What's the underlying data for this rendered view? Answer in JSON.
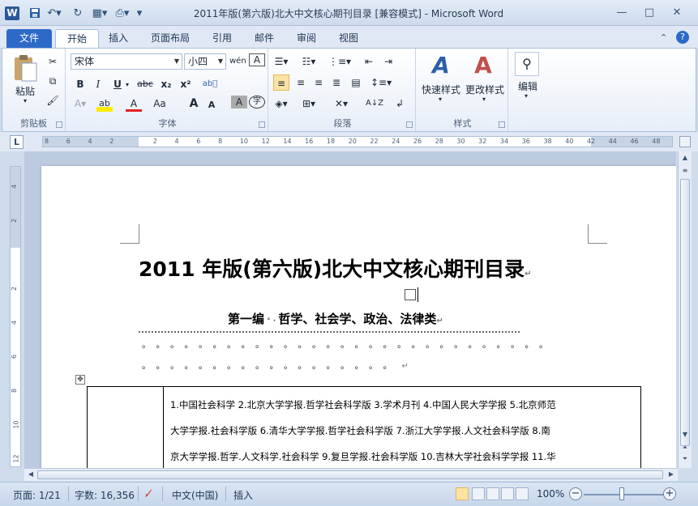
{
  "window": {
    "title": "2011年版(第六版)北大中文核心期刊目录 [兼容模式] - Microsoft Word",
    "app_icon": "W",
    "controls": {
      "minimize": "—",
      "maximize": "□",
      "close": "✕"
    }
  },
  "ribbon_tabs": [
    "文件",
    "开始",
    "插入",
    "页面布局",
    "引用",
    "邮件",
    "审阅",
    "视图"
  ],
  "ribbon": {
    "clipboard": {
      "paste_label": "粘贴",
      "group_label": "剪贴板"
    },
    "font": {
      "font_name": "宋体",
      "font_size": "小四",
      "bold": "B",
      "italic": "I",
      "underline": "U",
      "strike": "abc",
      "subscript": "x₂",
      "superscript": "x²",
      "grow": "A",
      "shrink": "A",
      "case": "Aa",
      "font_color": "A",
      "highlight": "ab",
      "char_border": "A",
      "enclose": "字",
      "phonetic": "wén",
      "group_label": "字体"
    },
    "paragraph": {
      "group_label": "段落"
    },
    "styles": {
      "quick_styles": "快速样式",
      "change_styles": "更改样式",
      "group_label": "样式"
    },
    "editing": {
      "label": "编辑"
    }
  },
  "ruler": {
    "corner": "L",
    "ticks": [
      "8",
      "6",
      "4",
      "2",
      "",
      "2",
      "4",
      "6",
      "8",
      "10",
      "12",
      "14",
      "16",
      "18",
      "20",
      "22",
      "24",
      "26",
      "28",
      "30",
      "32",
      "34",
      "36",
      "38",
      "40",
      "42",
      "44",
      "46",
      "48"
    ],
    "vticks": [
      "4",
      "2",
      "",
      "2",
      "4",
      "6",
      "8",
      "10",
      "12"
    ]
  },
  "document": {
    "title": "2011 年版(第六版)北大中文核心期刊目录",
    "subtitle": "第一编",
    "subtitle_rest": "哲学、社会学、政治、法律类",
    "para_mark": "↵",
    "dots_row1": "。。。。。。。。。。。。。。。。。。。。。。。。。。。。。",
    "dots_row2": "。。。。。。。。。。。。。。。。。。",
    "table_lines": [
      "1.中国社会科学  2.北京大学学报.哲学社会科学版  3.学术月刊  4.中国人民大学学报  5.北京师范",
      "大学学报.社会科学版  6.清华大学学报.哲学社会科学版  7.浙江大学学报.人文社会科学版  8.南",
      "京大学学报.哲学.人文科学.社会科学  9.复旦学报.社会科学版  10.吉林大学社会科学学报  11.华"
    ]
  },
  "statusbar": {
    "page": "页面: 1/21",
    "words": "字数: 16,356",
    "language": "中文(中国)",
    "mode": "插入",
    "zoom": "100%",
    "zoom_out": "−",
    "zoom_in": "+"
  }
}
